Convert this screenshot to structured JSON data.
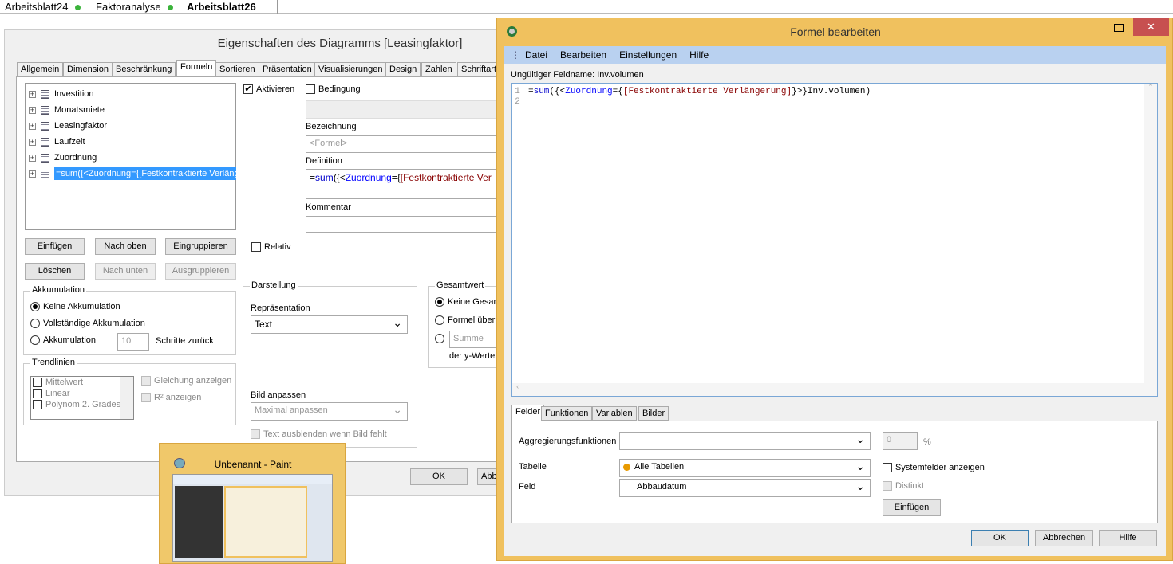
{
  "sheet_tabs": [
    {
      "label": "Arbeitsblatt24",
      "status": "green"
    },
    {
      "label": "Faktoranalyse",
      "status": "green"
    },
    {
      "label": "Arbeitsblatt26",
      "active": true
    }
  ],
  "props_dialog": {
    "title": "Eigenschaften des Diagramms [Leasingfaktor]",
    "tabs": [
      "Allgemein",
      "Dimension",
      "Beschränkung",
      "Formeln",
      "Sortieren",
      "Präsentation",
      "Visualisierungen",
      "Design",
      "Zahlen",
      "Schriftart"
    ],
    "active_tab": "Formeln",
    "expressions": [
      "Investition",
      "Monatsmiete",
      "Leasingfaktor",
      "Laufzeit",
      "Zuordnung",
      "=sum({<Zuordnung={[Festkontraktierte Verläng"
    ],
    "buttons": {
      "insert": "Einfügen",
      "up": "Nach oben",
      "group": "Eingruppieren",
      "delete": "Löschen",
      "down": "Nach unten",
      "ungroup": "Ausgruppieren",
      "ok": "OK",
      "cancel_partial": "Abb"
    },
    "activate": "Aktivieren",
    "condition": "Bedingung",
    "label_caption": "Bezeichnung",
    "label_placeholder": "<Formel>",
    "definition_caption": "Definition",
    "definition": {
      "p1": "=",
      "p2": "sum",
      "p3": "({<",
      "p4": "Zuordnung",
      "p5": "={",
      "p6": "[Festkontraktierte Ver"
    },
    "comment_caption": "Kommentar",
    "relative": "Relativ",
    "accumulation": {
      "title": "Akkumulation",
      "none": "Keine Akkumulation",
      "full": "Vollständige Akkumulation",
      "acc": "Akkumulation",
      "steps": "10",
      "steps_label": "Schritte zurück"
    },
    "trendlines": {
      "title": "Trendlinien",
      "items": [
        "Mittelwert",
        "Linear",
        "Polynom 2. Grades"
      ],
      "show_eq": "Gleichung anzeigen",
      "show_r2": "R² anzeigen"
    },
    "display": {
      "title": "Darstellung",
      "rep_label": "Repräsentation",
      "rep_value": "Text",
      "img_label": "Bild anpassen",
      "img_value": "Maximal anpassen",
      "hide_text": "Text ausblenden wenn Bild fehlt"
    },
    "total": {
      "title": "Gesamtwert",
      "none": "Keine Gesam",
      "formula": "Formel über a",
      "sum": "Summe",
      "yvals": "der y-Werte"
    }
  },
  "paint_preview": {
    "title": "Unbenannt - Paint"
  },
  "formula_window": {
    "title": "Formel bearbeiten",
    "menu": [
      "Datei",
      "Bearbeiten",
      "Einstellungen",
      "Hilfe"
    ],
    "error": "Ungültiger Feldname: Inv.volumen",
    "lines": [
      "1",
      "2"
    ],
    "code": {
      "c1": "=",
      "c2": "sum",
      "c3": "({<",
      "c4": "Zuordnung",
      "c5": "={",
      "c6": "[Festkontraktierte Verlängerung]",
      "c7": "}>}Inv.volumen)"
    },
    "tabs": [
      "Felder",
      "Funktionen",
      "Variablen",
      "Bilder"
    ],
    "agg_label": "Aggregierungsfunktionen",
    "agg_value": "",
    "pct_value": "0",
    "pct": "%",
    "table_label": "Tabelle",
    "table_value": "Alle Tabellen",
    "field_label": "Feld",
    "field_value": "Abbaudatum",
    "sysfields": "Systemfelder anzeigen",
    "distinct": "Distinkt",
    "insert": "Einfügen",
    "ok": "OK",
    "cancel": "Abbrechen",
    "help": "Hilfe"
  }
}
